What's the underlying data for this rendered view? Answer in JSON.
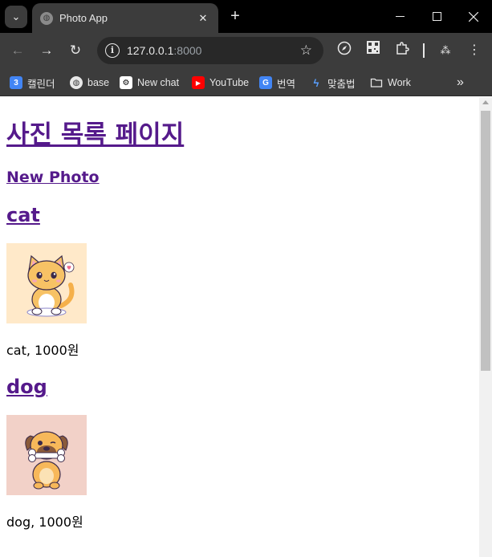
{
  "browser": {
    "tab_title": "Photo App",
    "url_host": "127.0.0.1",
    "url_port": ":8000",
    "bookmarks": [
      {
        "label": "캘린더",
        "icon": "calendar-icon",
        "icon_text": "3",
        "color": "#4285f4"
      },
      {
        "label": "base",
        "icon": "globe-icon",
        "icon_text": "◍",
        "color": "#e8e8e8"
      },
      {
        "label": "New chat",
        "icon": "chatgpt-icon",
        "icon_text": "⚙",
        "color": "#ffffff"
      },
      {
        "label": "YouTube",
        "icon": "youtube-icon",
        "icon_text": "▶",
        "color": "#ff0000"
      },
      {
        "label": "번역",
        "icon": "google-translate-icon",
        "icon_text": "G",
        "color": "#4285f4"
      },
      {
        "label": "맞춤법",
        "icon": "spellcheck-icon",
        "icon_text": "ϟ",
        "color": "#5aa0ff"
      },
      {
        "label": "Work",
        "icon": "folder-icon",
        "icon_text": "",
        "color": "#e8e8e8"
      }
    ]
  },
  "page": {
    "heading": "사진 목록 페이지",
    "new_photo_link": "New Photo",
    "photos": [
      {
        "title": "cat",
        "caption": "cat, 1000원",
        "bg": "#ffe9c9",
        "animal": "cat-illustration"
      },
      {
        "title": "dog",
        "caption": "dog, 1000원",
        "bg": "#f2d1c8",
        "animal": "dog-illustration"
      }
    ]
  },
  "colors": {
    "link": "#551a8b",
    "chrome_dark": "#3c3c3c",
    "tabbar": "#000000"
  }
}
